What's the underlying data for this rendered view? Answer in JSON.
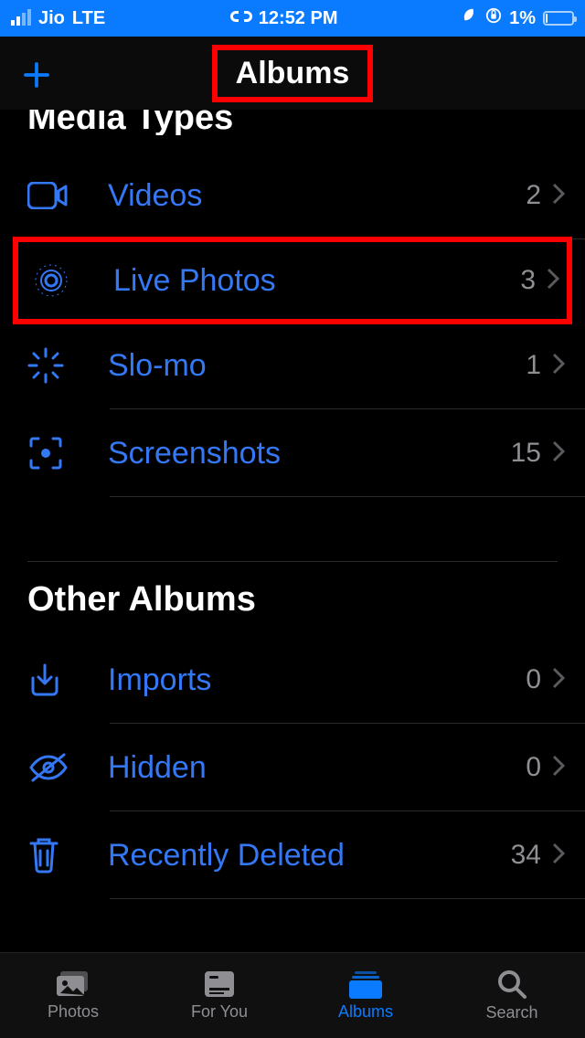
{
  "status": {
    "carrier": "Jio",
    "network": "LTE",
    "time": "12:52 PM",
    "battery_pct": "1%"
  },
  "header": {
    "title": "Albums"
  },
  "sections": {
    "media_types": {
      "title": "Media Types",
      "items": [
        {
          "label": "Videos",
          "count": "2"
        },
        {
          "label": "Live Photos",
          "count": "3"
        },
        {
          "label": "Slo-mo",
          "count": "1"
        },
        {
          "label": "Screenshots",
          "count": "15"
        }
      ]
    },
    "other_albums": {
      "title": "Other Albums",
      "items": [
        {
          "label": "Imports",
          "count": "0"
        },
        {
          "label": "Hidden",
          "count": "0"
        },
        {
          "label": "Recently Deleted",
          "count": "34"
        }
      ]
    }
  },
  "tabs": {
    "photos": "Photos",
    "foryou": "For You",
    "albums": "Albums",
    "search": "Search"
  }
}
